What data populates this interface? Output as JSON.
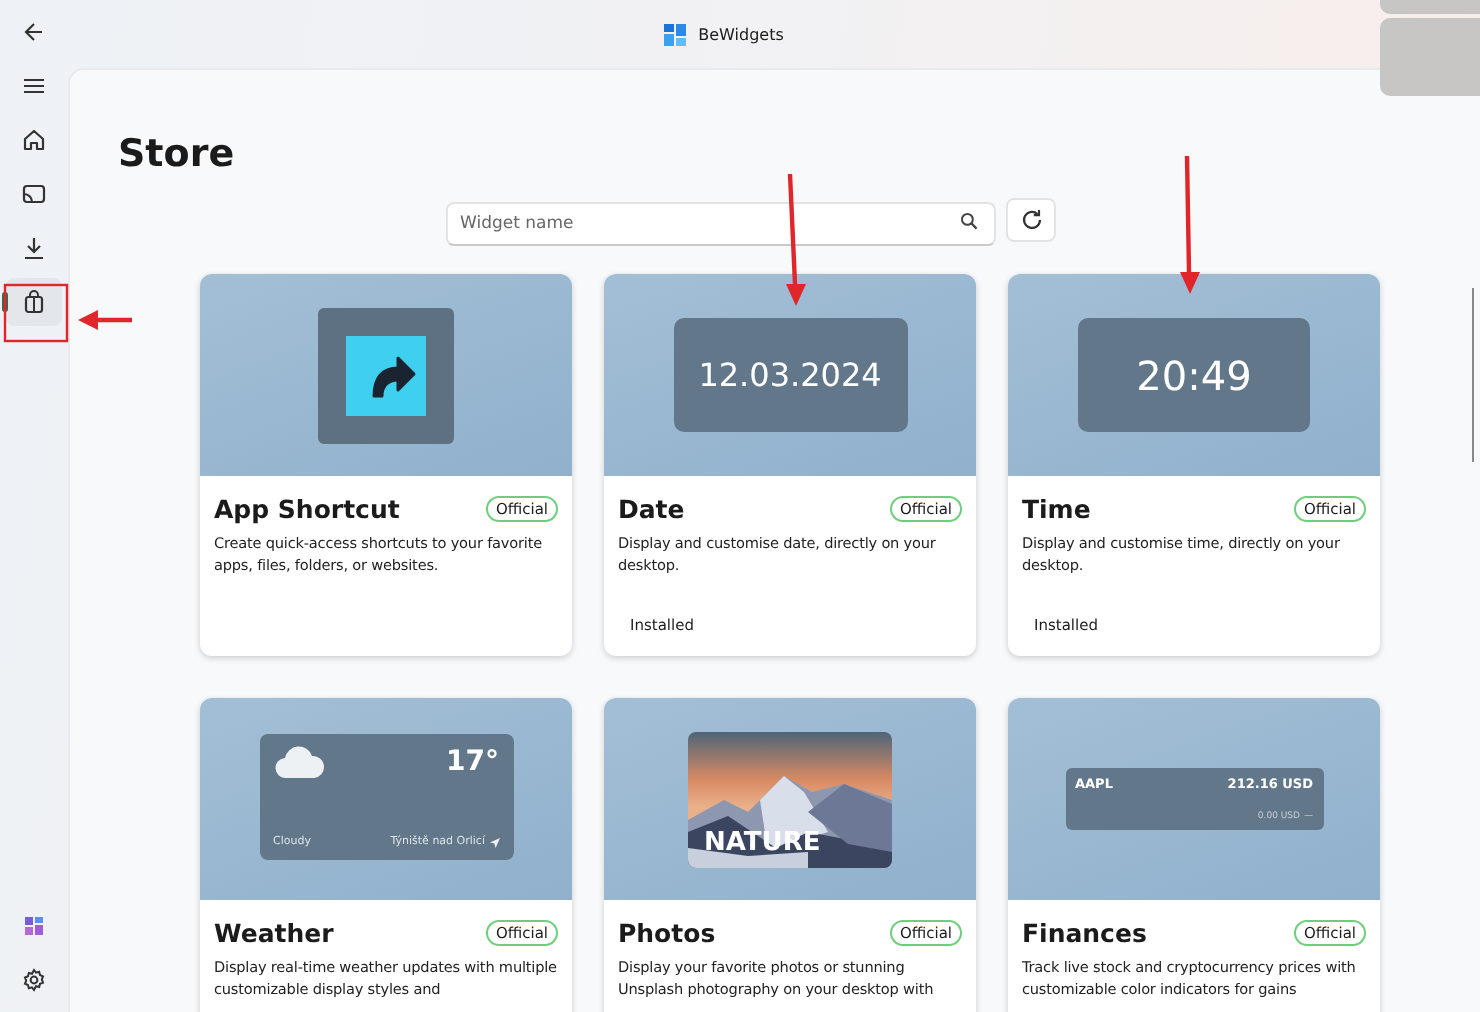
{
  "window": {
    "title": "BeWidgets"
  },
  "sidebar": {
    "items": [
      {
        "kind": "back",
        "selected": false
      },
      {
        "kind": "menu",
        "selected": false
      },
      {
        "kind": "home",
        "selected": false
      },
      {
        "kind": "cast",
        "selected": false
      },
      {
        "kind": "download",
        "selected": false
      },
      {
        "kind": "store",
        "selected": true
      }
    ],
    "footer_items": [
      {
        "kind": "widgets",
        "selected": false
      },
      {
        "kind": "settings",
        "selected": false
      }
    ]
  },
  "page": {
    "title": "Store"
  },
  "search": {
    "placeholder": "Widget name"
  },
  "widgets": [
    {
      "name": "App Shortcut",
      "badge": "Official",
      "description": "Create quick-access shortcuts to your favorite apps, files, folders, or websites.",
      "preview": {
        "kind": "shortcut"
      }
    },
    {
      "name": "Date",
      "badge": "Official",
      "description": "Display and customise date, directly on your desktop.",
      "status": "Installed",
      "preview": {
        "kind": "date",
        "text": "12.03.2024"
      }
    },
    {
      "name": "Time",
      "badge": "Official",
      "description": "Display and customise time, directly on your desktop.",
      "status": "Installed",
      "preview": {
        "kind": "time",
        "text": "20:49"
      }
    },
    {
      "name": "Weather",
      "badge": "Official",
      "description": "Display real-time weather updates with multiple customizable display styles and",
      "preview": {
        "kind": "weather",
        "temperature": "17°",
        "condition": "Cloudy",
        "location": "Týniště nad Orlicí"
      }
    },
    {
      "name": "Photos",
      "badge": "Official",
      "description": "Display your favorite photos or stunning Unsplash photography on your desktop with",
      "preview": {
        "caption": "NATURE"
      }
    },
    {
      "name": "Finances",
      "badge": "Official",
      "description": "Track live stock and cryptocurrency prices with customizable color indicators for gains",
      "preview": {
        "kind": "finance",
        "symbol": "AAPL",
        "price": "212.16 USD",
        "change": "0.00 USD",
        "trend": "—"
      }
    }
  ],
  "annotations": [
    {
      "kind": "highlight-frame"
    },
    {
      "kind": "arrow-left"
    },
    {
      "kind": "arrow-down-date"
    },
    {
      "kind": "arrow-down-time"
    }
  ]
}
